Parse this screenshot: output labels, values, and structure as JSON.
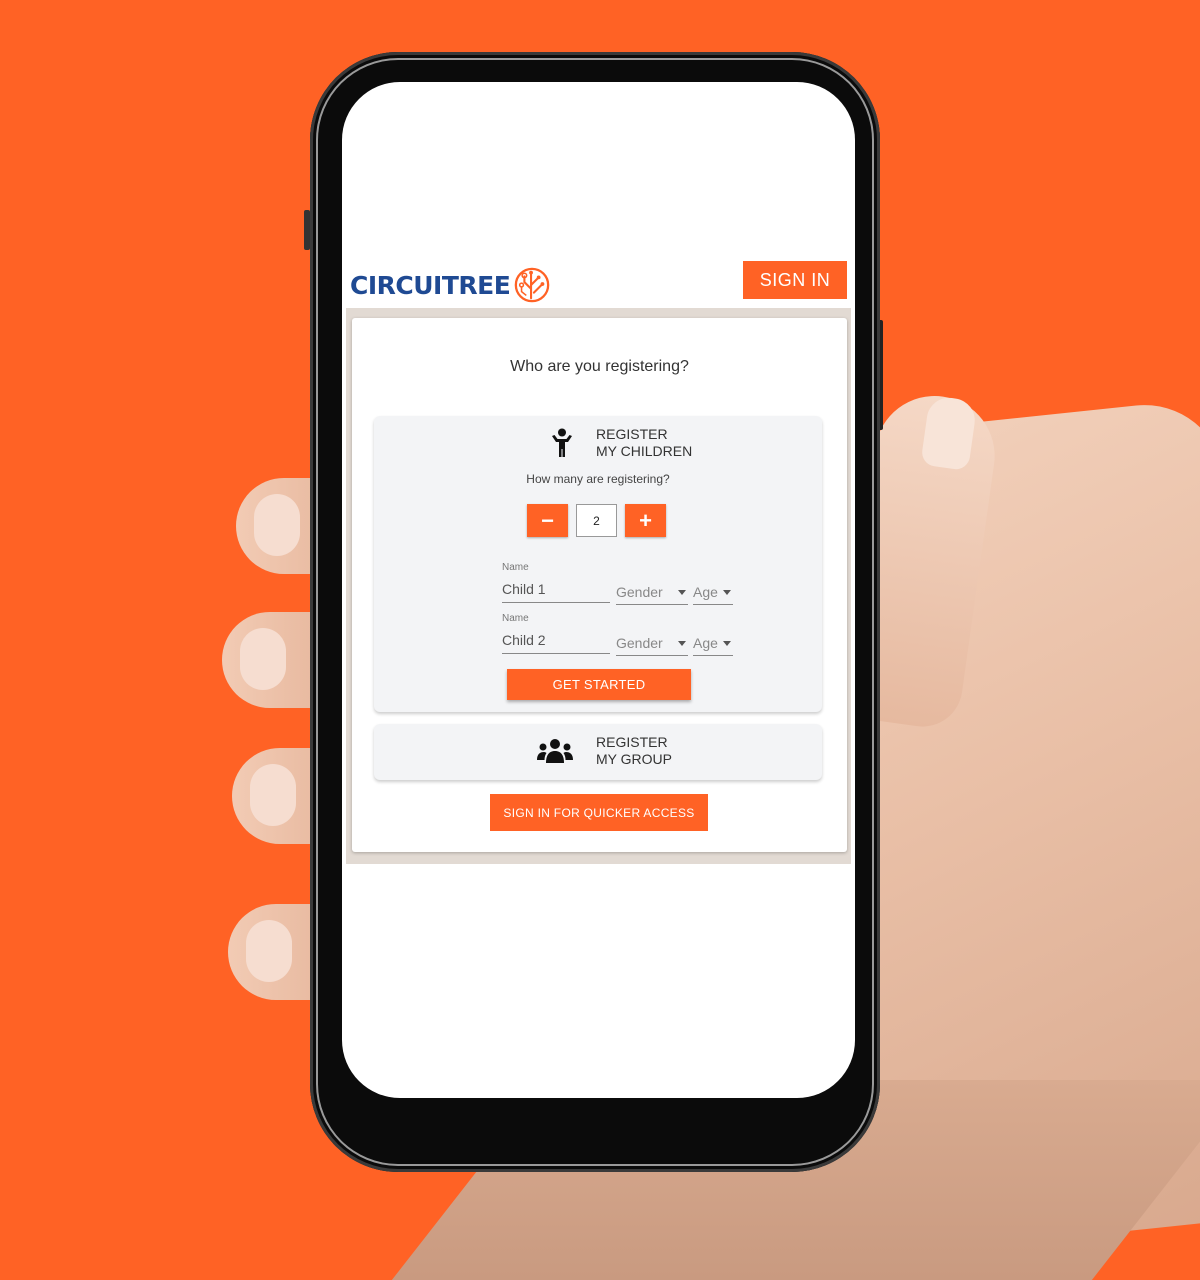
{
  "colors": {
    "background": "#ff6225",
    "brand_blue": "#1f4a93",
    "accent": "#ff6225",
    "panel": "#f3f4f6"
  },
  "header": {
    "logo_text": "CIRCUITREE",
    "logo_icon": "circuit-tree-icon",
    "signin_label": "SIGN IN"
  },
  "main": {
    "question": "Who are you registering?",
    "children_panel": {
      "icon": "child-icon",
      "title_line1": "REGISTER",
      "title_line2": "MY CHILDREN",
      "count_prompt": "How many are registering?",
      "count_value": "2",
      "minus_label": "−",
      "plus_label": "+",
      "children": [
        {
          "name_label": "Name",
          "name_value": "Child 1",
          "gender_placeholder": "Gender",
          "age_placeholder": "Age"
        },
        {
          "name_label": "Name",
          "name_value": "Child 2",
          "gender_placeholder": "Gender",
          "age_placeholder": "Age"
        }
      ],
      "submit_label": "GET STARTED"
    },
    "group_panel": {
      "icon": "group-icon",
      "title_line1": "REGISTER",
      "title_line2": "MY GROUP"
    },
    "quick_signin_label": "SIGN IN FOR QUICKER ACCESS"
  }
}
